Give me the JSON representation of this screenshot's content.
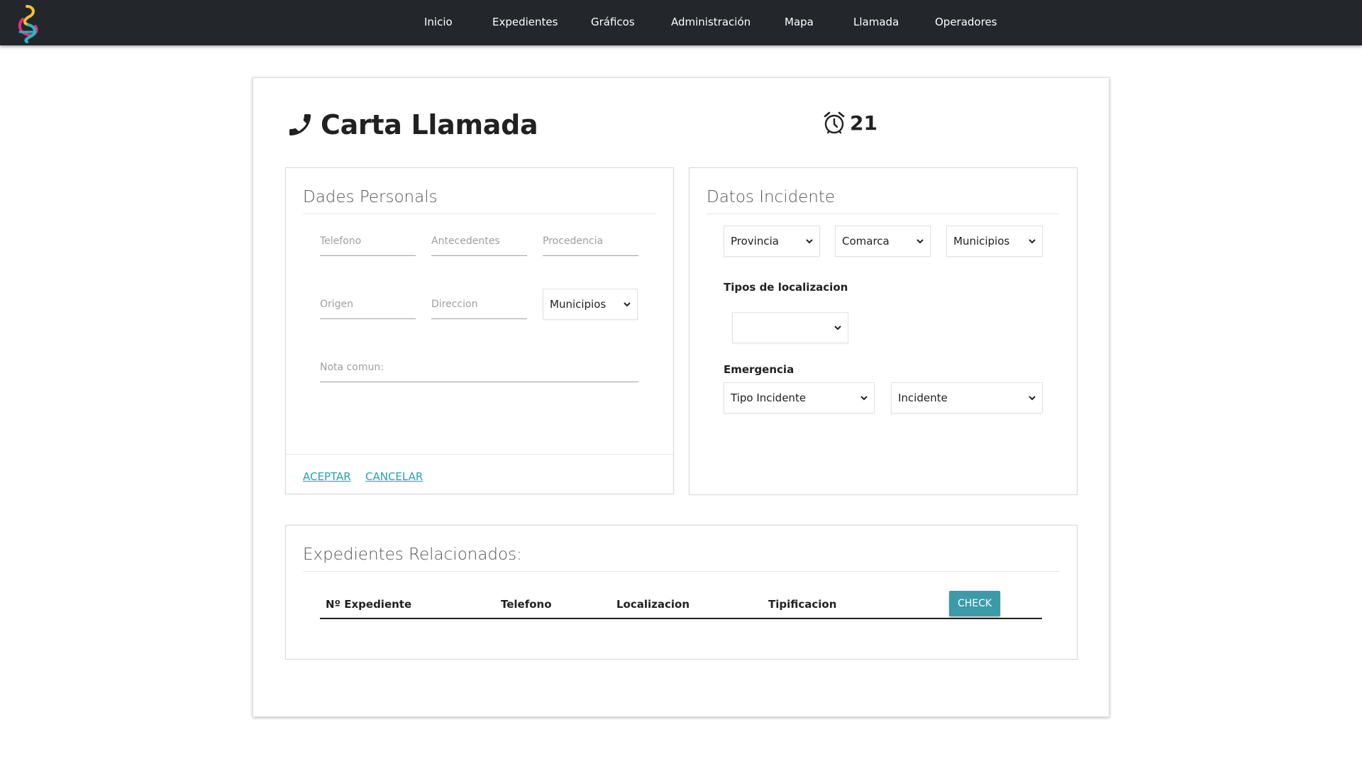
{
  "nav": {
    "items": [
      "Inicio",
      "Expedientes",
      "Gráficos",
      "Administración",
      "Mapa",
      "Llamada",
      "Operadores"
    ]
  },
  "page": {
    "title": "Carta Llamada",
    "timer": "21"
  },
  "personal": {
    "title": "Dades Personals",
    "telefono_placeholder": "Telefono",
    "antecedentes_placeholder": "Antecedentes",
    "procedencia_placeholder": "Procedencia",
    "origen_placeholder": "Origen",
    "direccion_placeholder": "Direccion",
    "municipios_select": "Municipios",
    "nota_placeholder": "Nota comun:",
    "aceptar": "ACEPTAR",
    "cancelar": "CANCELAR"
  },
  "incidente": {
    "title": "Datos Incidente",
    "provincia_select": "Provincia",
    "comarca_select": "Comarca",
    "municipios_select": "Municipios",
    "tipos_label": "Tipos de localizacion",
    "tipos_select": "",
    "emergencia_label": "Emergencia",
    "tipo_incidente_select": "Tipo Incidente",
    "incidente_select": "Incidente"
  },
  "expedientes": {
    "title": "Expedientes Relacionados:",
    "columns": [
      "Nº Expediente",
      "Telefono",
      "Localizacion",
      "Tipificacion"
    ],
    "check_label": "CHECK"
  },
  "colors": {
    "navbar": "#23272b",
    "accent": "#26a0b0",
    "check_button": "#3c9ba8"
  }
}
